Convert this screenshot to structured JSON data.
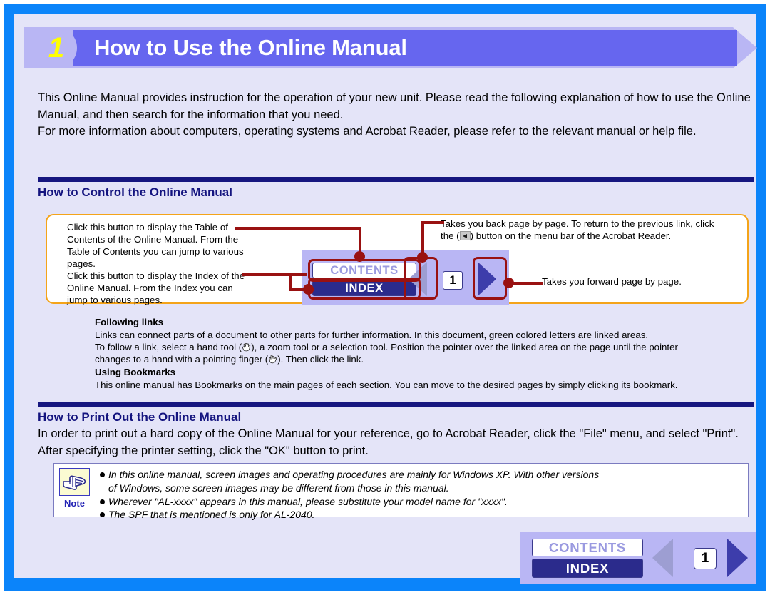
{
  "header": {
    "number": "1",
    "title": "How to Use the Online Manual"
  },
  "intro": "This Online Manual provides instruction for the operation of your new unit. Please read the following explanation of how to use the Online Manual, and then search for the information that you need.\nFor more information about computers, operating systems and Acrobat Reader, please refer to the relevant manual or help file.",
  "sections": [
    {
      "heading": "How to Control the Online Manual"
    },
    {
      "heading": "How to Print Out the Online Manual"
    }
  ],
  "callout": {
    "top_left": "Click this button to display the Table of Contents of the Online Manual. From the Table of Contents you can jump to various pages.",
    "bottom_left": "Click this button to display the Index of the Online Manual. From the Index you can jump to various pages.",
    "top_right_part1": "Takes you back page by page. To return to the previous link, click the (",
    "top_right_icon": "back-arrow-icon",
    "top_right_part2": ") button on the menu bar of the Acrobat Reader.",
    "bottom_right": "Takes you forward page by page."
  },
  "nav_figure": {
    "contents_label": "CONTENTS",
    "index_label": "INDEX",
    "page_number": "1",
    "back_icon": "triangle-left-icon",
    "forward_icon": "triangle-right-icon"
  },
  "links_block": {
    "heading1": "Following links",
    "line1": "Links can connect parts of a document to other parts for further information. In this document, green colored letters are linked areas.",
    "line2_a": "To follow a link, select a hand tool (",
    "line2_b": "), a zoom tool or a selection tool. Position the pointer over the linked area on the page until the pointer",
    "line3_a": "changes to a hand with a pointing finger (",
    "line3_b": "). Then click the link.",
    "heading2": "Using Bookmarks",
    "line4": "This online manual has Bookmarks on the main pages of each section. You can move to the desired pages by simply clicking its bookmark."
  },
  "print_section": {
    "body": "In order to print out a hard copy of the Online Manual for your reference, go to Acrobat Reader, click the \"File\" menu, and select \"Print\". After specifying the printer setting, click the \"OK\" button to print."
  },
  "note": {
    "label": "Note",
    "icon": "pointing-hand-icon",
    "line1": "In this online manual, screen images and operating procedures are mainly for Windows XP. With other versions",
    "line1b": "of Windows, some screen images may be different from those in this manual.",
    "line2": "Wherever \"AL-xxxx\" appears in this manual, please substitute your model name for \"xxxx\".",
    "line3": "The SPF that is mentioned is only for AL-2040."
  },
  "bottom_nav": {
    "contents_label": "CONTENTS",
    "index_label": "INDEX",
    "page_number": "1",
    "back_icon": "triangle-left-icon",
    "forward_icon": "triangle-right-icon"
  },
  "colors": {
    "frame_blue": "#0b84fa",
    "page_lavender": "#e4e4f8",
    "banner_purple": "#6666ef",
    "banner_light_purple": "#b9b6f4",
    "heading_navy": "#14147f",
    "rule_navy": "#161680",
    "callout_orange": "#f4a41a",
    "leader_dark_red": "#991111",
    "index_navy": "#2b2b8c",
    "contents_disabled_text": "#9a9ae0",
    "arrow_active": "#3d3dab",
    "arrow_disabled": "#9d9ed2",
    "note_icon_bg": "#fbfbd2",
    "note_label_blue": "#2424b5",
    "banner_number_yellow": "#ffff00"
  }
}
